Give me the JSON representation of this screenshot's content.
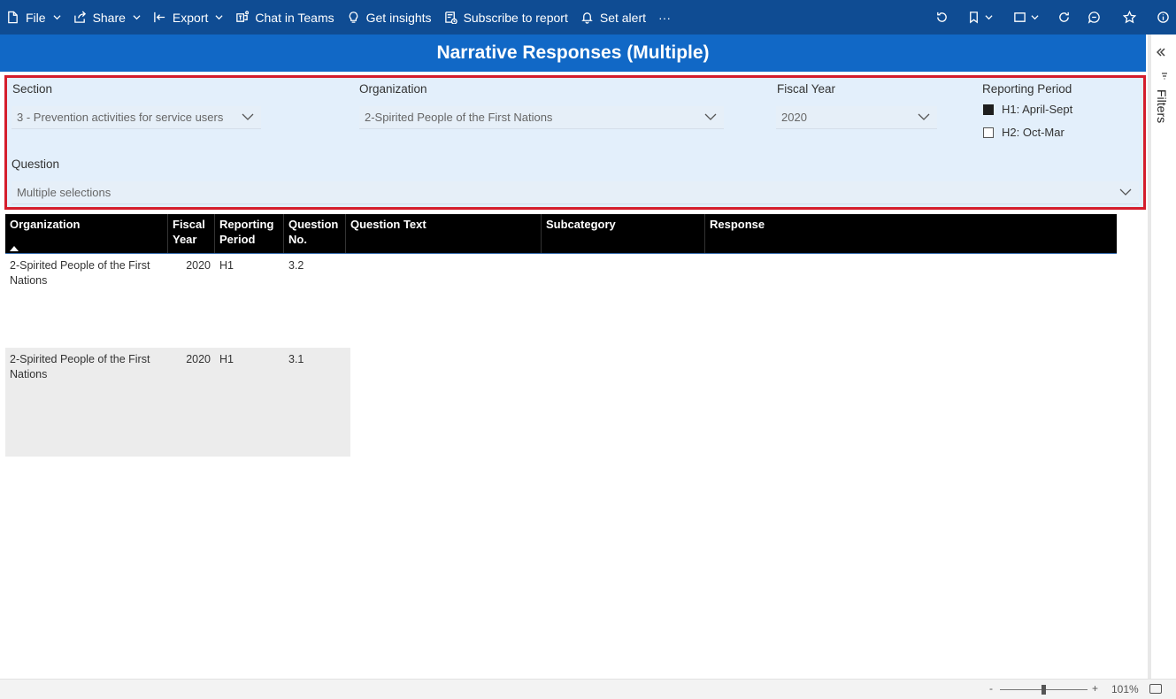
{
  "toolbar": {
    "file": "File",
    "share": "Share",
    "export": "Export",
    "chat_in_teams": "Chat in Teams",
    "get_insights": "Get insights",
    "subscribe": "Subscribe to report",
    "set_alert": "Set alert",
    "more": "···"
  },
  "report": {
    "title": "Narrative Responses (Multiple)"
  },
  "filters": {
    "section": {
      "label": "Section",
      "value": "3 - Prevention activities for service users"
    },
    "organization": {
      "label": "Organization",
      "value": "2-Spirited People of the First Nations"
    },
    "fiscal_year": {
      "label": "Fiscal Year",
      "value": "2020"
    },
    "reporting_period": {
      "label": "Reporting Period",
      "options": [
        {
          "label": "H1: April-Sept",
          "checked": true
        },
        {
          "label": "H2: Oct-Mar",
          "checked": false
        }
      ]
    },
    "question": {
      "label": "Question",
      "value": "Multiple selections"
    }
  },
  "table": {
    "columns": {
      "organization": "Organization",
      "fiscal_year": "Fiscal Year",
      "reporting_period": "Reporting Period",
      "question_no": "Question No.",
      "question_text": "Question Text",
      "subcategory": "Subcategory",
      "response": "Response"
    },
    "rows": [
      {
        "organization": "2-Spirited People of the First Nations",
        "fiscal_year": "2020",
        "reporting_period": "H1",
        "question_no": "3.2"
      },
      {
        "organization": "2-Spirited People of the First Nations",
        "fiscal_year": "2020",
        "reporting_period": "H1",
        "question_no": "3.1"
      }
    ]
  },
  "filters_pane": {
    "label": "Filters"
  },
  "statusbar": {
    "zoom_level": "101%",
    "zoom_minus": "-",
    "zoom_plus": "+"
  }
}
